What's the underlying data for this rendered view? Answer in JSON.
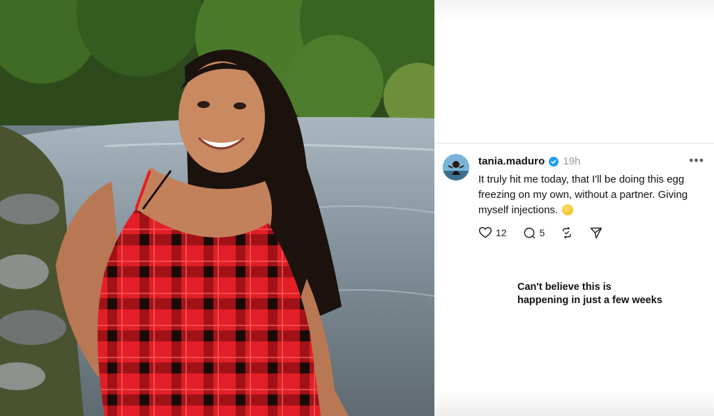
{
  "photo": {
    "alt_subject": "woman-in-red-plaid-dress-by-river"
  },
  "post": {
    "username": "tania.maduro",
    "verified_icon": "verified-badge-icon",
    "time": "19h",
    "more_label": "•••",
    "text": "It truly hit me today, that I'll be doing this egg freezing on my own, without a partner. Giving myself injections.",
    "emoji_icon": "relieved-face-emoji",
    "actions": {
      "likes": "12",
      "comments": "5",
      "like_icon": "heart-icon",
      "comment_icon": "comment-bubble-icon",
      "repost_icon": "repost-icon",
      "share_icon": "send-icon"
    }
  },
  "caption": {
    "line1": "Can't believe this is",
    "line2": "happening in just a few weeks"
  },
  "colors": {
    "verified": "#1d9bf0",
    "dress_red": "#e21f26",
    "text": "#111111",
    "muted": "#999999"
  }
}
